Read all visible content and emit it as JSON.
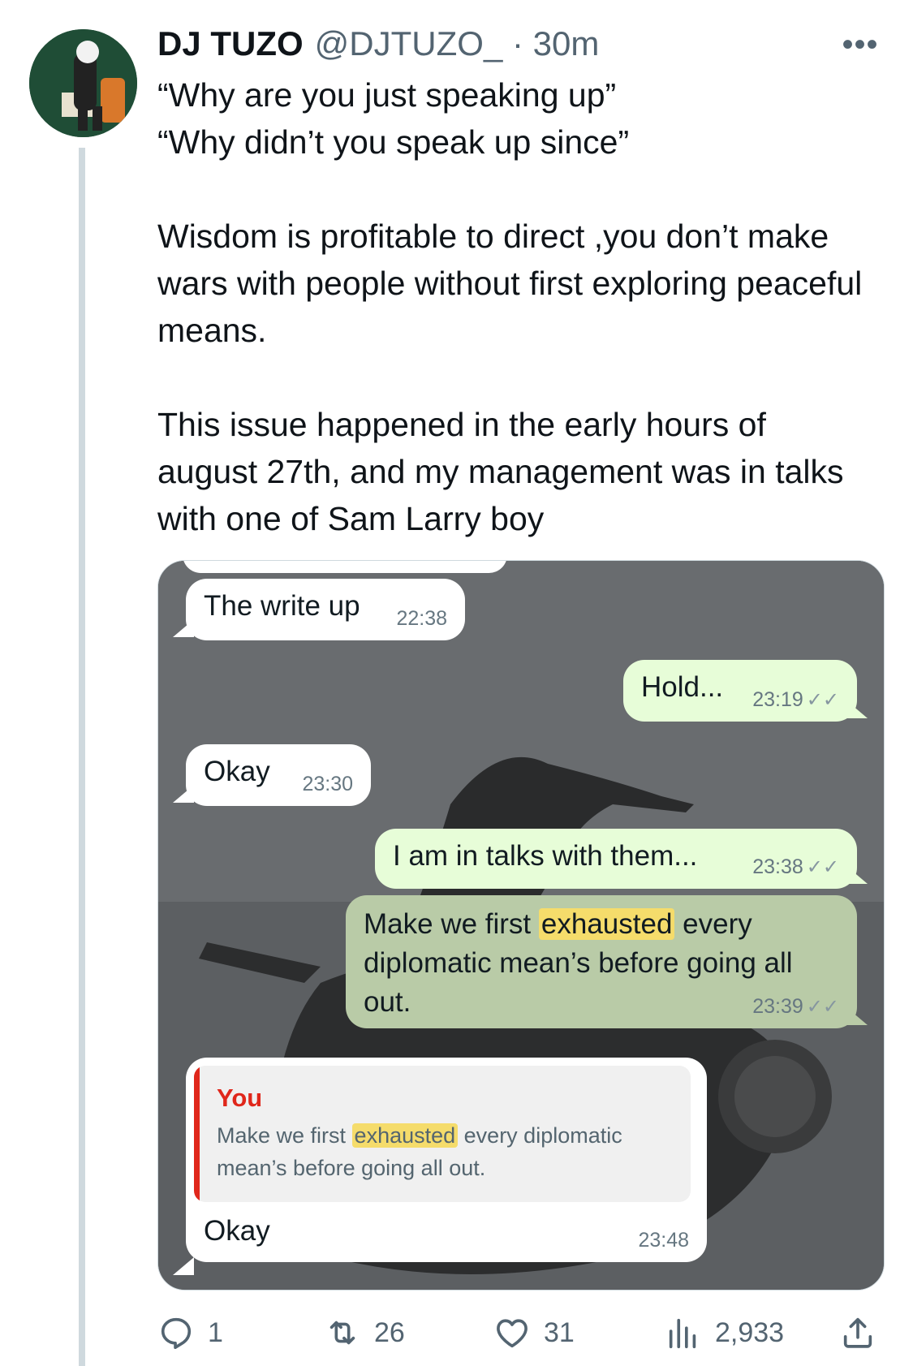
{
  "tweet": {
    "author_name": "DJ TUZO",
    "handle_time": "@DJTUZO_ · 30m",
    "more_icon": "more-dots-icon",
    "text": "“Why are you just speaking up”\n“Why didn’t you speak up since”\n\nWisdom is profitable to direct ,you don’t make wars with people without first exploring peaceful means.\n\nThis issue happened in the early hours of august 27th, and my management was in talks with one of Sam Larry boy"
  },
  "chat": {
    "messages": [
      {
        "direction": "in",
        "text": "The write up",
        "time": "22:38"
      },
      {
        "direction": "out",
        "text": "Hold...",
        "time": "23:19",
        "ticks": "✓✓"
      },
      {
        "direction": "in",
        "text": "Okay",
        "time": "23:30"
      },
      {
        "direction": "out",
        "text": "I am in talks with them...",
        "time": "23:38",
        "ticks": "✓✓"
      },
      {
        "direction": "out",
        "text_before": "Make we first ",
        "highlight": "exhausted",
        "text_after_line1": " every",
        "line2": "diplomatic mean’s before going all",
        "line3": "out.",
        "time": "23:39",
        "ticks": "✓✓"
      },
      {
        "direction": "in",
        "quote_author": "You",
        "quote_before": "Make we first ",
        "quote_highlight": "exhausted",
        "quote_after": " every diplomatic mean’s before going all out.",
        "text": "Okay",
        "time": "23:48"
      }
    ],
    "colors": {
      "incoming": "#ffffff",
      "outgoing": "#e7fdd8",
      "selected": "#b9cba7",
      "highlight": "#f5dc6b",
      "quote_accent": "#e0271b"
    }
  },
  "actions": {
    "reply": {
      "icon": "reply-icon",
      "count": "1"
    },
    "retweet": {
      "icon": "retweet-icon",
      "count": "26"
    },
    "like": {
      "icon": "heart-icon",
      "count": "31"
    },
    "views": {
      "icon": "views-icon",
      "count": "2,933"
    },
    "share": {
      "icon": "share-icon"
    }
  }
}
